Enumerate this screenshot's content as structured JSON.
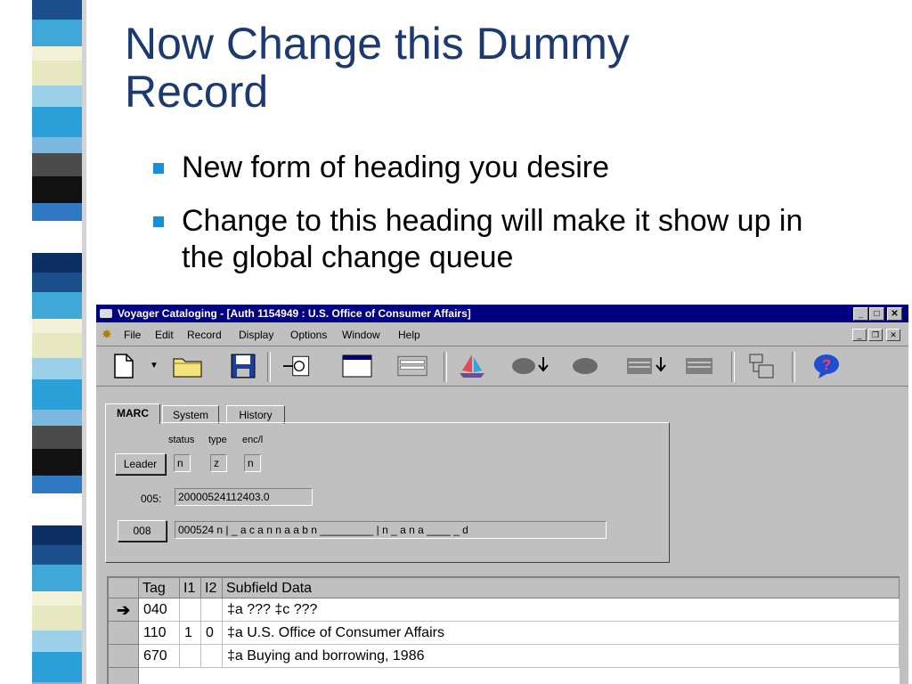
{
  "slide": {
    "title": "Now Change this Dummy\nRecord",
    "bullets": [
      "New form of heading you desire",
      "Change to this heading will make it show up in the global change queue"
    ]
  },
  "window": {
    "title": "Voyager Cataloging - [Auth 1154949 : U.S. Office of Consumer Affairs]",
    "menu": [
      "File",
      "Edit",
      "Record",
      "Display",
      "Options",
      "Window",
      "Help"
    ],
    "tabs": [
      "MARC",
      "System",
      "History"
    ],
    "leader": {
      "button": "Leader",
      "labels": [
        "status",
        "type",
        "enc/l"
      ],
      "values": [
        "n",
        "z",
        "n"
      ]
    },
    "field005": {
      "label": "005:",
      "value": "20000524112403.0"
    },
    "field008": {
      "button": "008",
      "value": "000524 n | _ a c a n n a a b n _________ | n _ a n a ____ _ d"
    },
    "grid": {
      "headers": [
        "Tag",
        "I1",
        "I2",
        "Subfield Data"
      ],
      "rows": [
        {
          "marker": "➔",
          "tag": "040",
          "i1": "",
          "i2": "",
          "data": "‡a ??? ‡c ???"
        },
        {
          "marker": "",
          "tag": "110",
          "i1": "1",
          "i2": "0",
          "data": "‡a U.S. Office of Consumer Affairs"
        },
        {
          "marker": "",
          "tag": "670",
          "i1": "",
          "i2": "",
          "data": "‡a Buying and borrowing, 1986"
        }
      ]
    }
  },
  "toolbar_icons": [
    "new-record-icon",
    "dropdown-arrow-icon",
    "open-folder-icon",
    "save-disk-icon",
    "retrieve-icon",
    "window-icon",
    "form-icon",
    "sailboat-icon",
    "attach-bib-icon",
    "bib-icon",
    "attach-holdings-icon",
    "holdings-icon",
    "hierarchy-icon",
    "help-icon"
  ],
  "colors": {
    "title": "#1c3a70",
    "bullet": "#1a8fd8",
    "titlebar": "#000080",
    "face": "#c0c0c0"
  }
}
